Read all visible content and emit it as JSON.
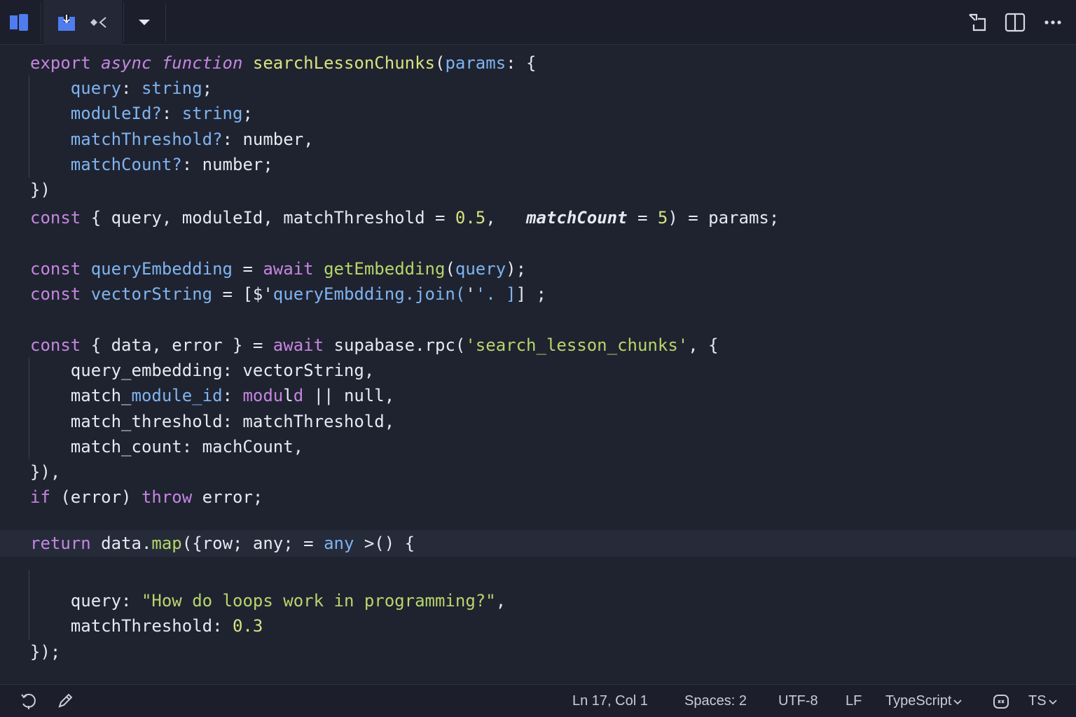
{
  "toolbar": {
    "left_icons": [
      "sidebar-icon",
      "save-icon",
      "nav-icon",
      "dropdown-icon"
    ],
    "right_icons": [
      "diff-icon",
      "split-editor-icon",
      "more-icon"
    ]
  },
  "code": {
    "lines": [
      [
        [
          "kw",
          "export "
        ],
        [
          "kwi",
          "async "
        ],
        [
          "kwi",
          "function "
        ],
        [
          "fn",
          "searchLessonChunks"
        ],
        [
          "plain",
          "("
        ],
        [
          "prop",
          "params"
        ],
        [
          "plain",
          ": {"
        ]
      ],
      [
        [
          "plain",
          "    "
        ],
        [
          "prop",
          "query"
        ],
        [
          "plain",
          ": "
        ],
        [
          "prop",
          "string"
        ],
        [
          "plain",
          ";"
        ]
      ],
      [
        [
          "plain",
          "    "
        ],
        [
          "prop",
          "moduleId?"
        ],
        [
          "plain",
          ": "
        ],
        [
          "prop",
          "string"
        ],
        [
          "plain",
          ";"
        ]
      ],
      [
        [
          "plain",
          "    "
        ],
        [
          "prop",
          "matchThreshold?"
        ],
        [
          "plain",
          ": number,"
        ]
      ],
      [
        [
          "plain",
          "    "
        ],
        [
          "prop",
          "matchCount?"
        ],
        [
          "plain",
          ": number;"
        ]
      ],
      [
        [
          "plain",
          "})"
        ]
      ],
      [
        [
          "kw",
          "const "
        ],
        [
          "plain",
          "{ query, moduleId, matchThreshold = "
        ],
        [
          "num",
          "0.5"
        ],
        [
          "plain",
          ",  "
        ],
        [
          "ital",
          " matchCount"
        ],
        [
          "plain",
          " = "
        ],
        [
          "num",
          "5"
        ],
        [
          "plain",
          ") = params;"
        ]
      ],
      [],
      [
        [
          "kw",
          "const "
        ],
        [
          "prop",
          "queryEmbedding"
        ],
        [
          "plain",
          " = "
        ],
        [
          "kw",
          "await "
        ],
        [
          "fn2",
          "getEmbedding"
        ],
        [
          "plain",
          "("
        ],
        [
          "prop",
          "query"
        ],
        [
          "plain",
          ");"
        ]
      ],
      [
        [
          "kw",
          "const "
        ],
        [
          "prop",
          "vectorString"
        ],
        [
          "plain",
          " = [$'"
        ],
        [
          "prop",
          "queryEmbdding.join("
        ],
        [
          "plain",
          "'"
        ],
        [
          "prop",
          "'. ]"
        ],
        [
          "plain",
          "] ;"
        ]
      ],
      [],
      [
        [
          "kw",
          "const "
        ],
        [
          "plain",
          "{ data, error } = "
        ],
        [
          "kw",
          "await "
        ],
        [
          "plain",
          "supabase.rpc("
        ],
        [
          "str",
          "'search_lesson_chunks'"
        ],
        [
          "plain",
          ", {"
        ]
      ],
      [
        [
          "plain",
          "    query_embedding: vectorString,"
        ]
      ],
      [
        [
          "plain",
          "    match_"
        ],
        [
          "prop",
          "module_id"
        ],
        [
          "plain",
          ": "
        ],
        [
          "kw",
          "modu"
        ],
        [
          "plain",
          "l"
        ],
        [
          "kw",
          "d"
        ],
        [
          "plain",
          " || null,"
        ]
      ],
      [
        [
          "plain",
          "    match_threshold: matchThreshold,"
        ]
      ],
      [
        [
          "plain",
          "    match_count: machCount,"
        ]
      ],
      [
        [
          "plain",
          "}),"
        ]
      ],
      [
        [
          "kw",
          "if "
        ],
        [
          "plain",
          "(error) "
        ],
        [
          "kw",
          "throw "
        ],
        [
          "plain",
          "error;"
        ]
      ],
      [],
      [
        [
          "kw",
          "return "
        ],
        [
          "plain",
          "data."
        ],
        [
          "fn2",
          "map"
        ],
        [
          "plain",
          "({row; any; = "
        ],
        [
          "prop",
          "any "
        ],
        [
          "plain",
          ">() {"
        ]
      ],
      [],
      [
        [
          "plain",
          "    query: "
        ],
        [
          "str",
          "\"How do loops work in programming?\""
        ],
        [
          "plain",
          ","
        ]
      ],
      [
        [
          "plain",
          "    matchThreshold: "
        ],
        [
          "num",
          "0.3"
        ]
      ],
      [
        [
          "plain",
          "});"
        ]
      ]
    ]
  },
  "status": {
    "position": "Ln 17, Col 1",
    "spaces": "Spaces: 2",
    "encoding": "UTF-8",
    "eol": "LF",
    "language": "TypeScript",
    "lang_short": "TS",
    "left_icons": [
      "sync-icon",
      "pencil-icon"
    ]
  },
  "colors": {
    "background": "#1f2330",
    "keyword": "#c586e0",
    "function": "#d7e37f",
    "property": "#7fb4f0",
    "string": "#b7d66a"
  }
}
